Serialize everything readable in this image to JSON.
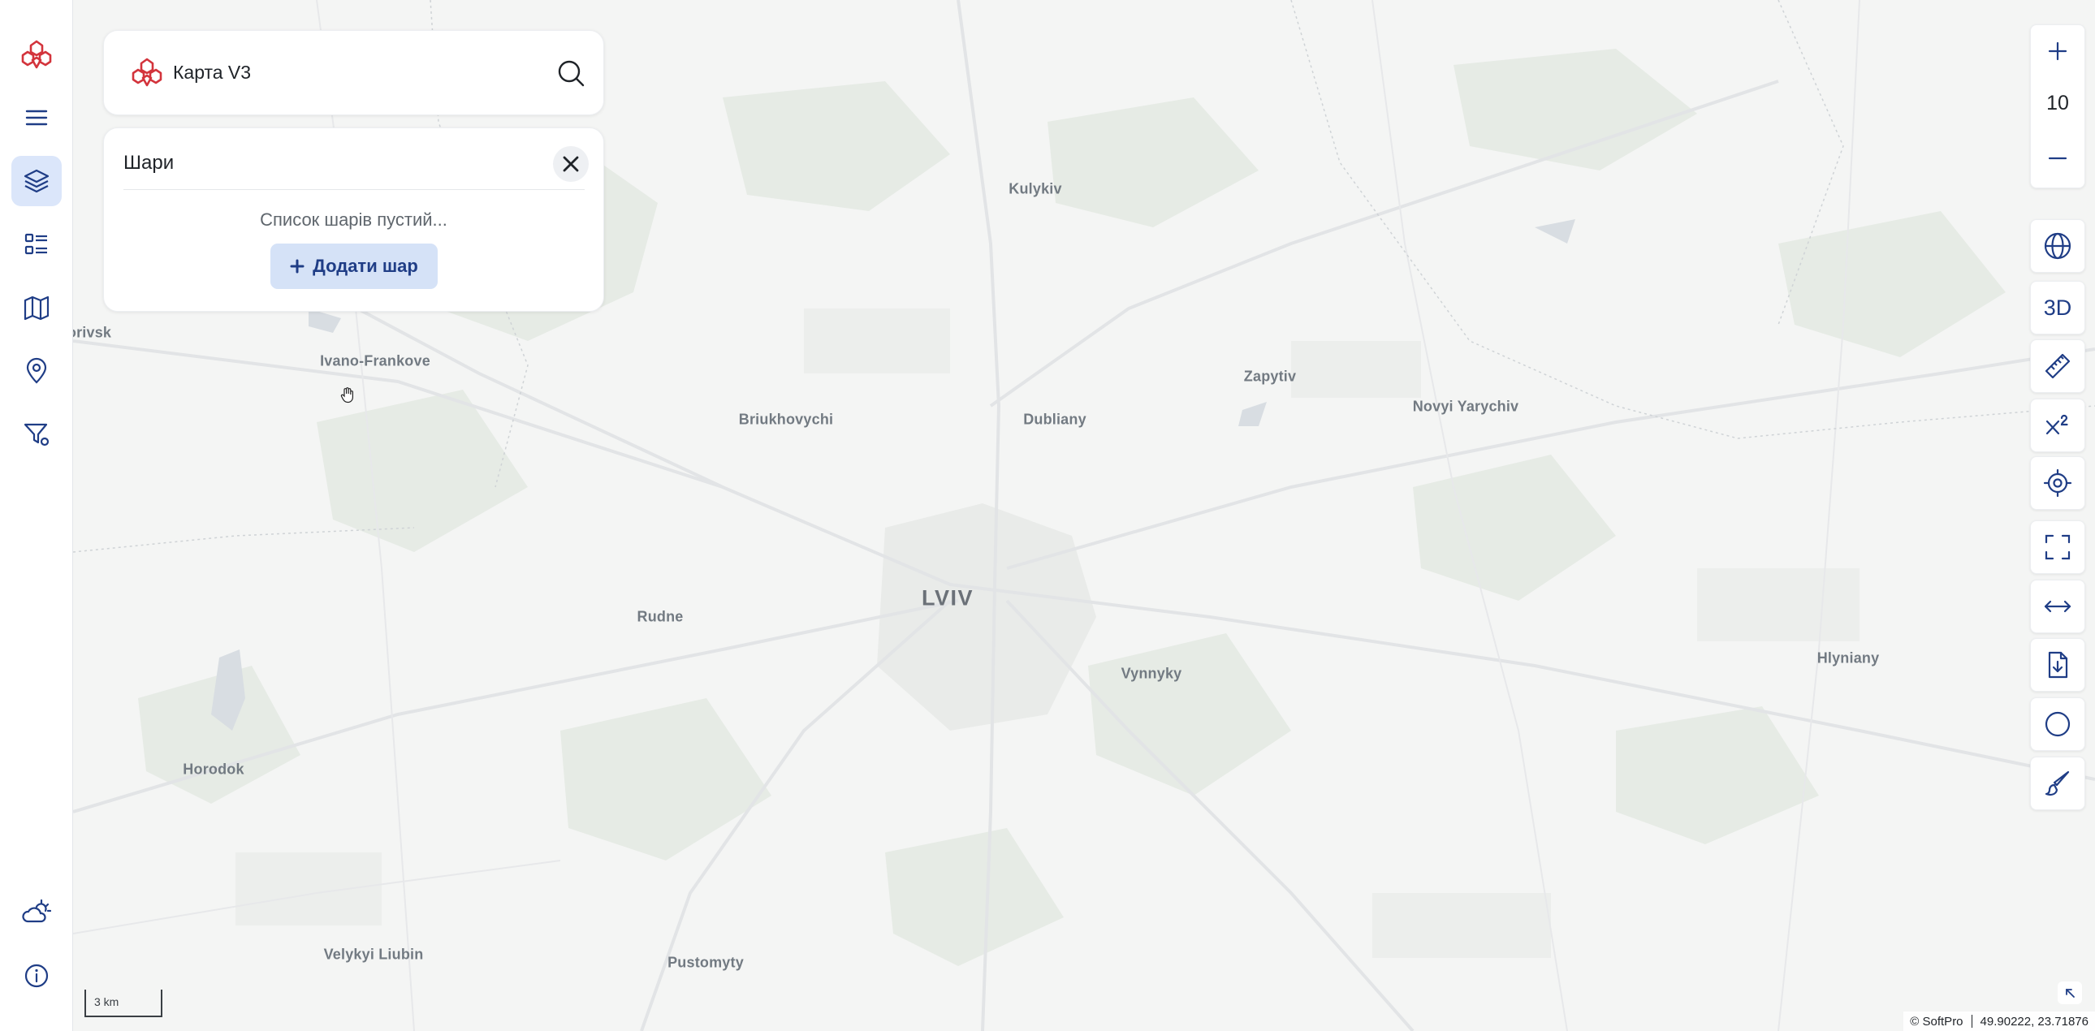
{
  "app": {
    "title": "Карта V3"
  },
  "left_rail": {
    "items": [
      {
        "name": "logo",
        "icon": "logo-icon"
      },
      {
        "name": "menu",
        "icon": "hamburger-icon"
      },
      {
        "name": "layers",
        "icon": "layers-icon",
        "active": true
      },
      {
        "name": "list",
        "icon": "list-icon"
      },
      {
        "name": "map",
        "icon": "map-icon"
      },
      {
        "name": "location",
        "icon": "pin-icon"
      },
      {
        "name": "filter",
        "icon": "filter-location-icon"
      },
      {
        "name": "weather",
        "icon": "weather-icon"
      },
      {
        "name": "info",
        "icon": "info-icon"
      }
    ]
  },
  "layers_panel": {
    "title": "Шари",
    "empty_text": "Список шарів пустий...",
    "add_button": "Додати шар"
  },
  "map": {
    "zoom": "10",
    "places": [
      {
        "name": "Kulykiv",
        "kind": "village"
      },
      {
        "name": "orivsk",
        "kind": "village"
      },
      {
        "name": "Ivano-Frankove",
        "kind": "village"
      },
      {
        "name": "Zapytiv",
        "kind": "village"
      },
      {
        "name": "Novyi Yarychiv",
        "kind": "village"
      },
      {
        "name": "Briukhovychi",
        "kind": "village"
      },
      {
        "name": "Dubliany",
        "kind": "village"
      },
      {
        "name": "LVIV",
        "kind": "city"
      },
      {
        "name": "Rudne",
        "kind": "village"
      },
      {
        "name": "Vynnyky",
        "kind": "village"
      },
      {
        "name": "Hlyniany",
        "kind": "village"
      },
      {
        "name": "Horodok",
        "kind": "village"
      },
      {
        "name": "Velykyi Liubin",
        "kind": "village"
      },
      {
        "name": "Pustomyty",
        "kind": "village"
      }
    ],
    "scale_label": "3 km",
    "attribution": "© SoftPro",
    "coordinates": "49.90222, 23.71876"
  },
  "toolbar": {
    "label_3d": "3D",
    "items": [
      "zoom-in-icon",
      "zoom-out-icon",
      "globe-icon",
      "3d",
      "ruler-icon",
      "superscript-icon",
      "locate-icon",
      "fullscreen-icon",
      "width-arrows-icon",
      "export-icon",
      "circle-icon",
      "brush-icon"
    ]
  },
  "colors": {
    "accent": "#1f3d86",
    "brand": "#d3343c",
    "active_bg": "#dbe6fa",
    "map_bg": "#f4f5f4"
  }
}
